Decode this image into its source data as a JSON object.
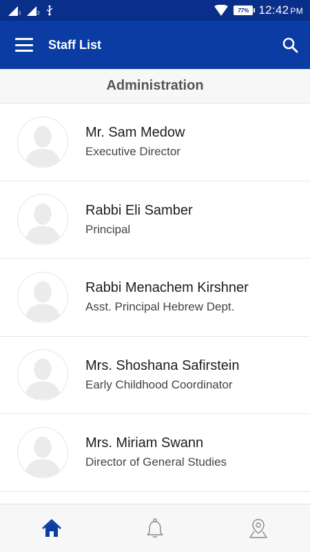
{
  "status_bar": {
    "sim1": "1",
    "sim2": "2",
    "battery": "77%",
    "time": "12:42",
    "ampm": "PM"
  },
  "app_bar": {
    "title": "Staff List",
    "menu_icon": "hamburger-menu-icon",
    "search_icon": "search-icon"
  },
  "section": {
    "title": "Administration"
  },
  "staff": [
    {
      "name": "Mr. Sam Medow",
      "title": "Executive Director"
    },
    {
      "name": "Rabbi Eli Samber",
      "title": "Principal"
    },
    {
      "name": "Rabbi Menachem Kirshner",
      "title": "Asst. Principal Hebrew Dept."
    },
    {
      "name": "Mrs. Shoshana Safirstein",
      "title": "Early Childhood Coordinator"
    },
    {
      "name": "Mrs. Miriam Swann",
      "title": "Director of General Studies"
    }
  ],
  "bottom_nav": {
    "items": [
      "home-icon",
      "bell-icon",
      "map-pin-icon"
    ],
    "active": "home-icon"
  },
  "colors": {
    "status_bar": "#0a2f8a",
    "app_bar": "#0a3ca3",
    "nav_active": "#0a3ca3",
    "nav_inactive": "#888888"
  }
}
